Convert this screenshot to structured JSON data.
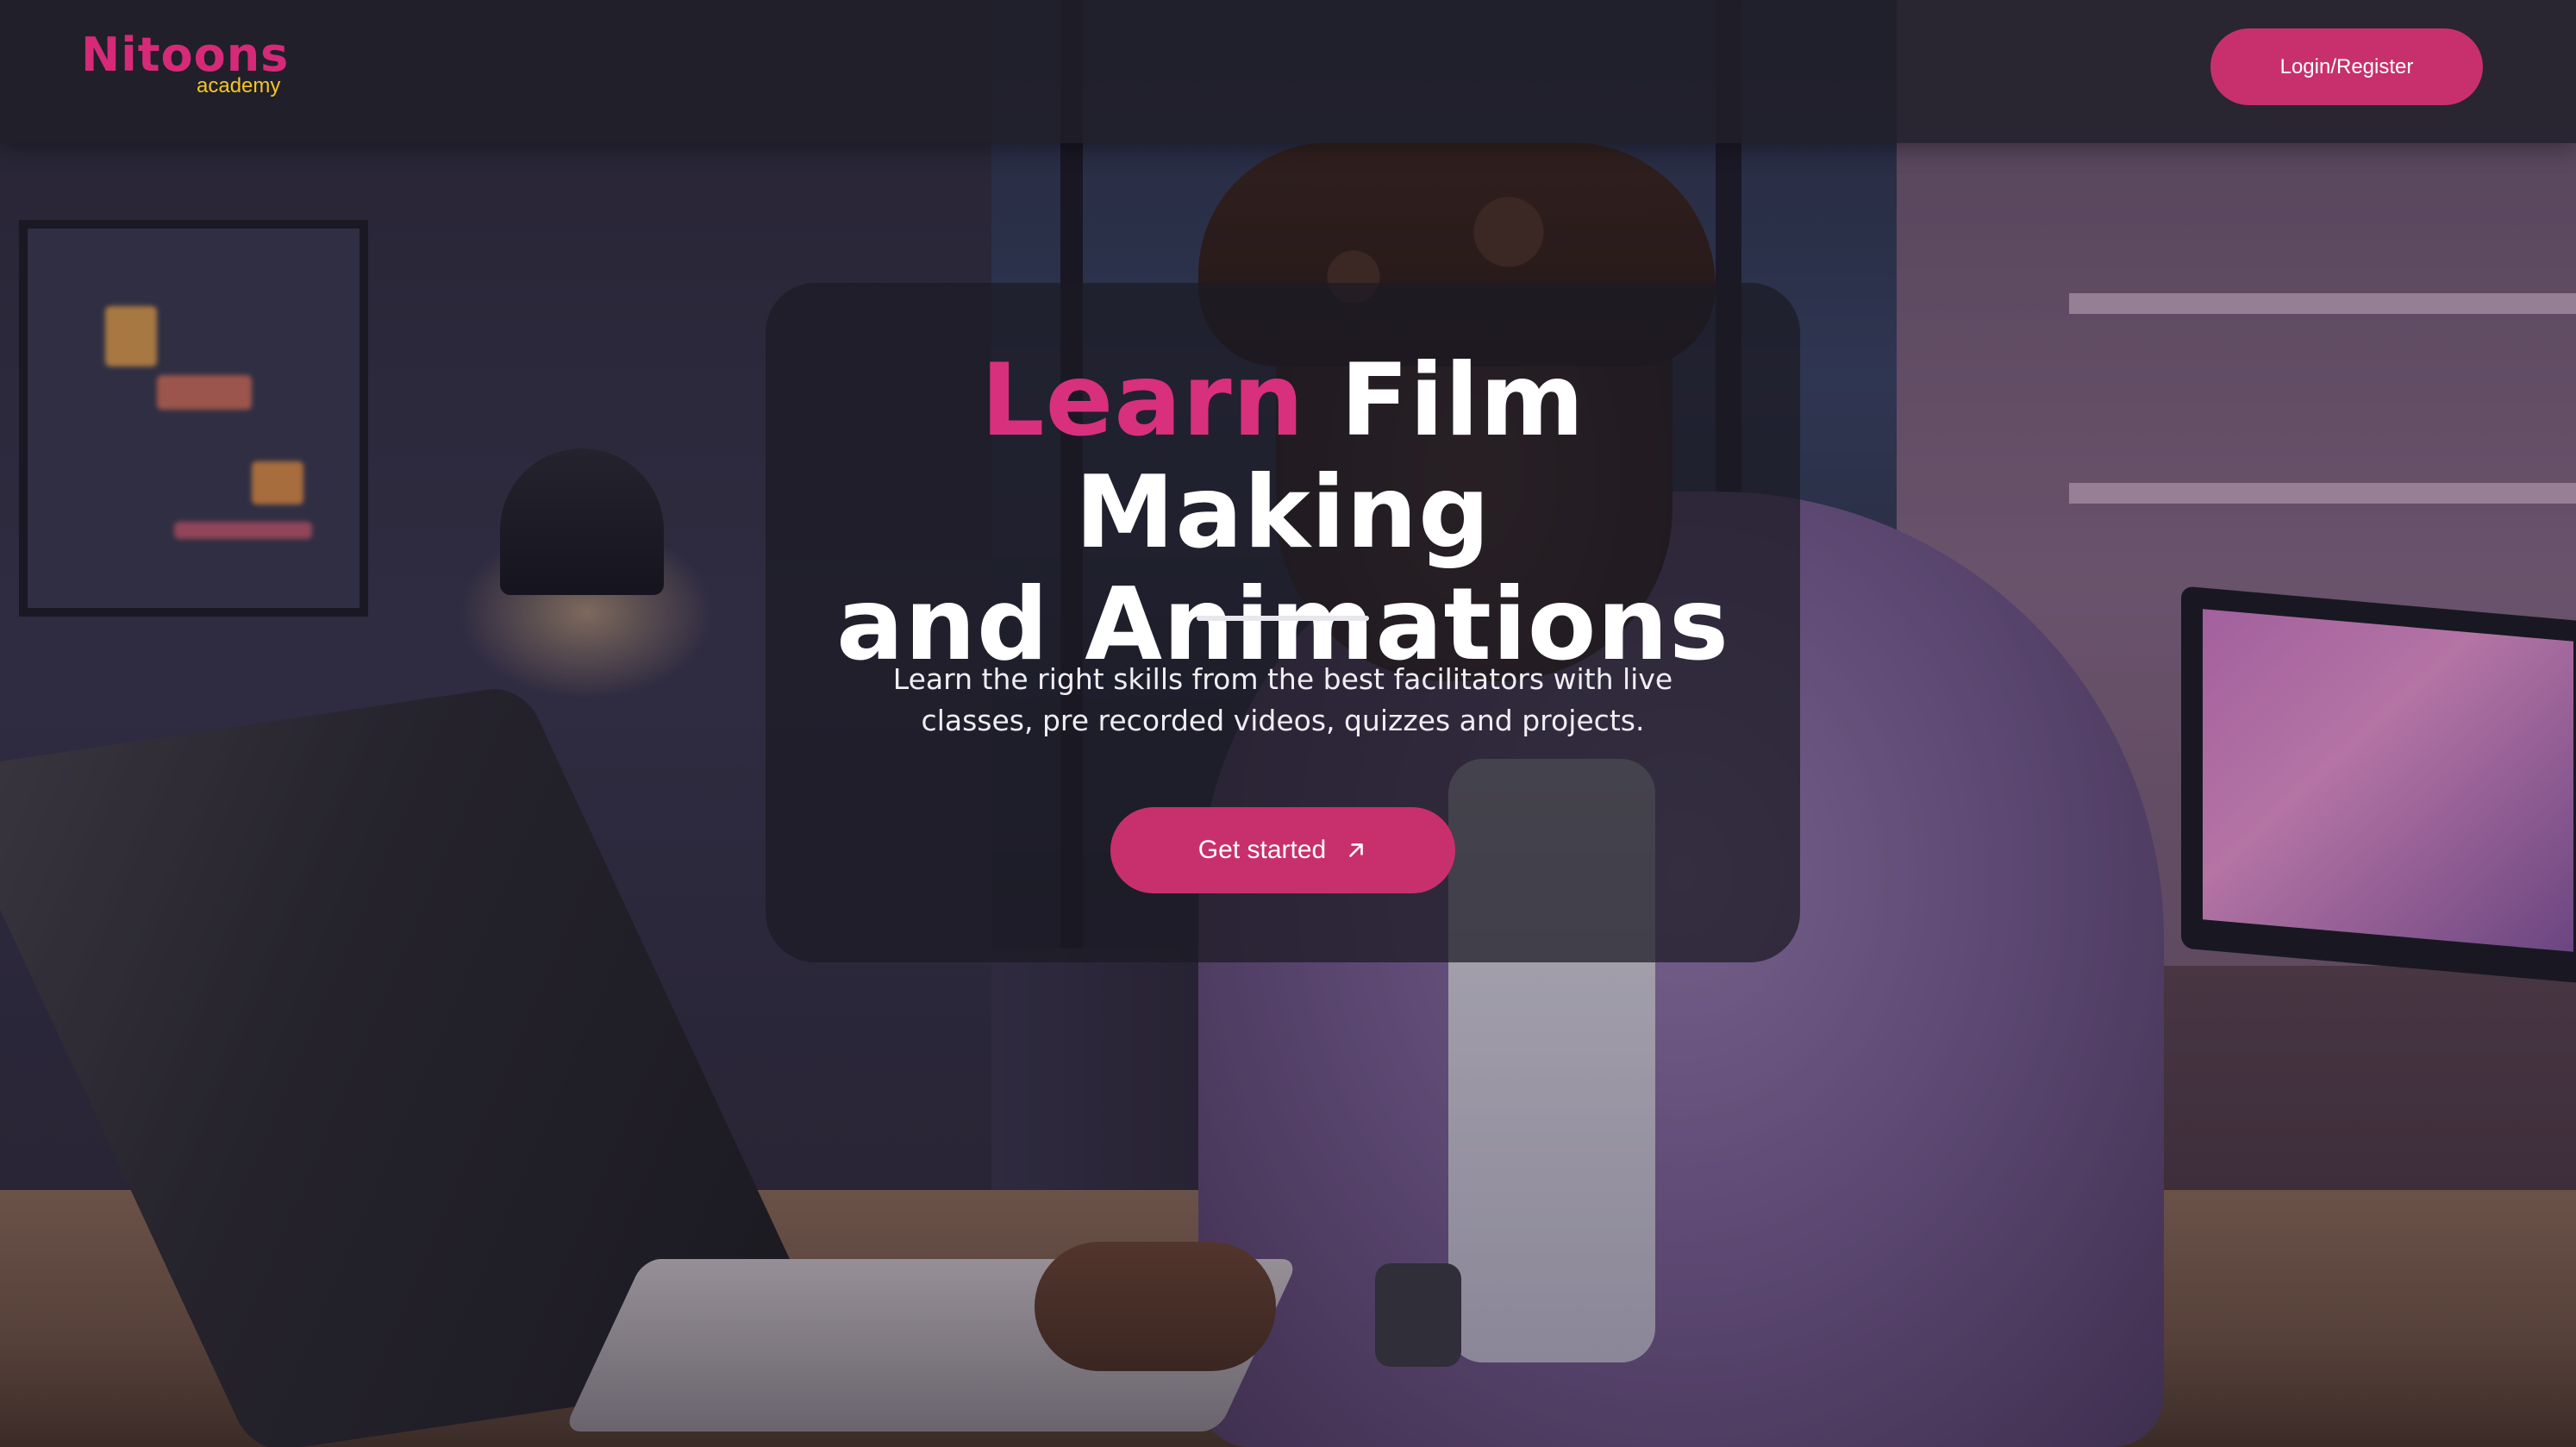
{
  "header": {
    "logo": {
      "word": "Nitoons",
      "sub": "academy"
    },
    "login_label": "Login/Register"
  },
  "hero": {
    "title_accent": "Learn",
    "title_rest_line1": "Film Making",
    "title_line2": "and Animations",
    "subtitle": "Learn the right skills from the best facilitators with live classes, pre recorded videos, quizzes and projects.",
    "cta_label": "Get started",
    "cta_icon": "arrow-up-right-icon"
  },
  "colors": {
    "brand_pink": "#c8306d",
    "logo_pink": "#d62a78",
    "logo_yellow": "#f3c623",
    "header_bg": "#201e28",
    "card_bg": "#1c1a24"
  }
}
